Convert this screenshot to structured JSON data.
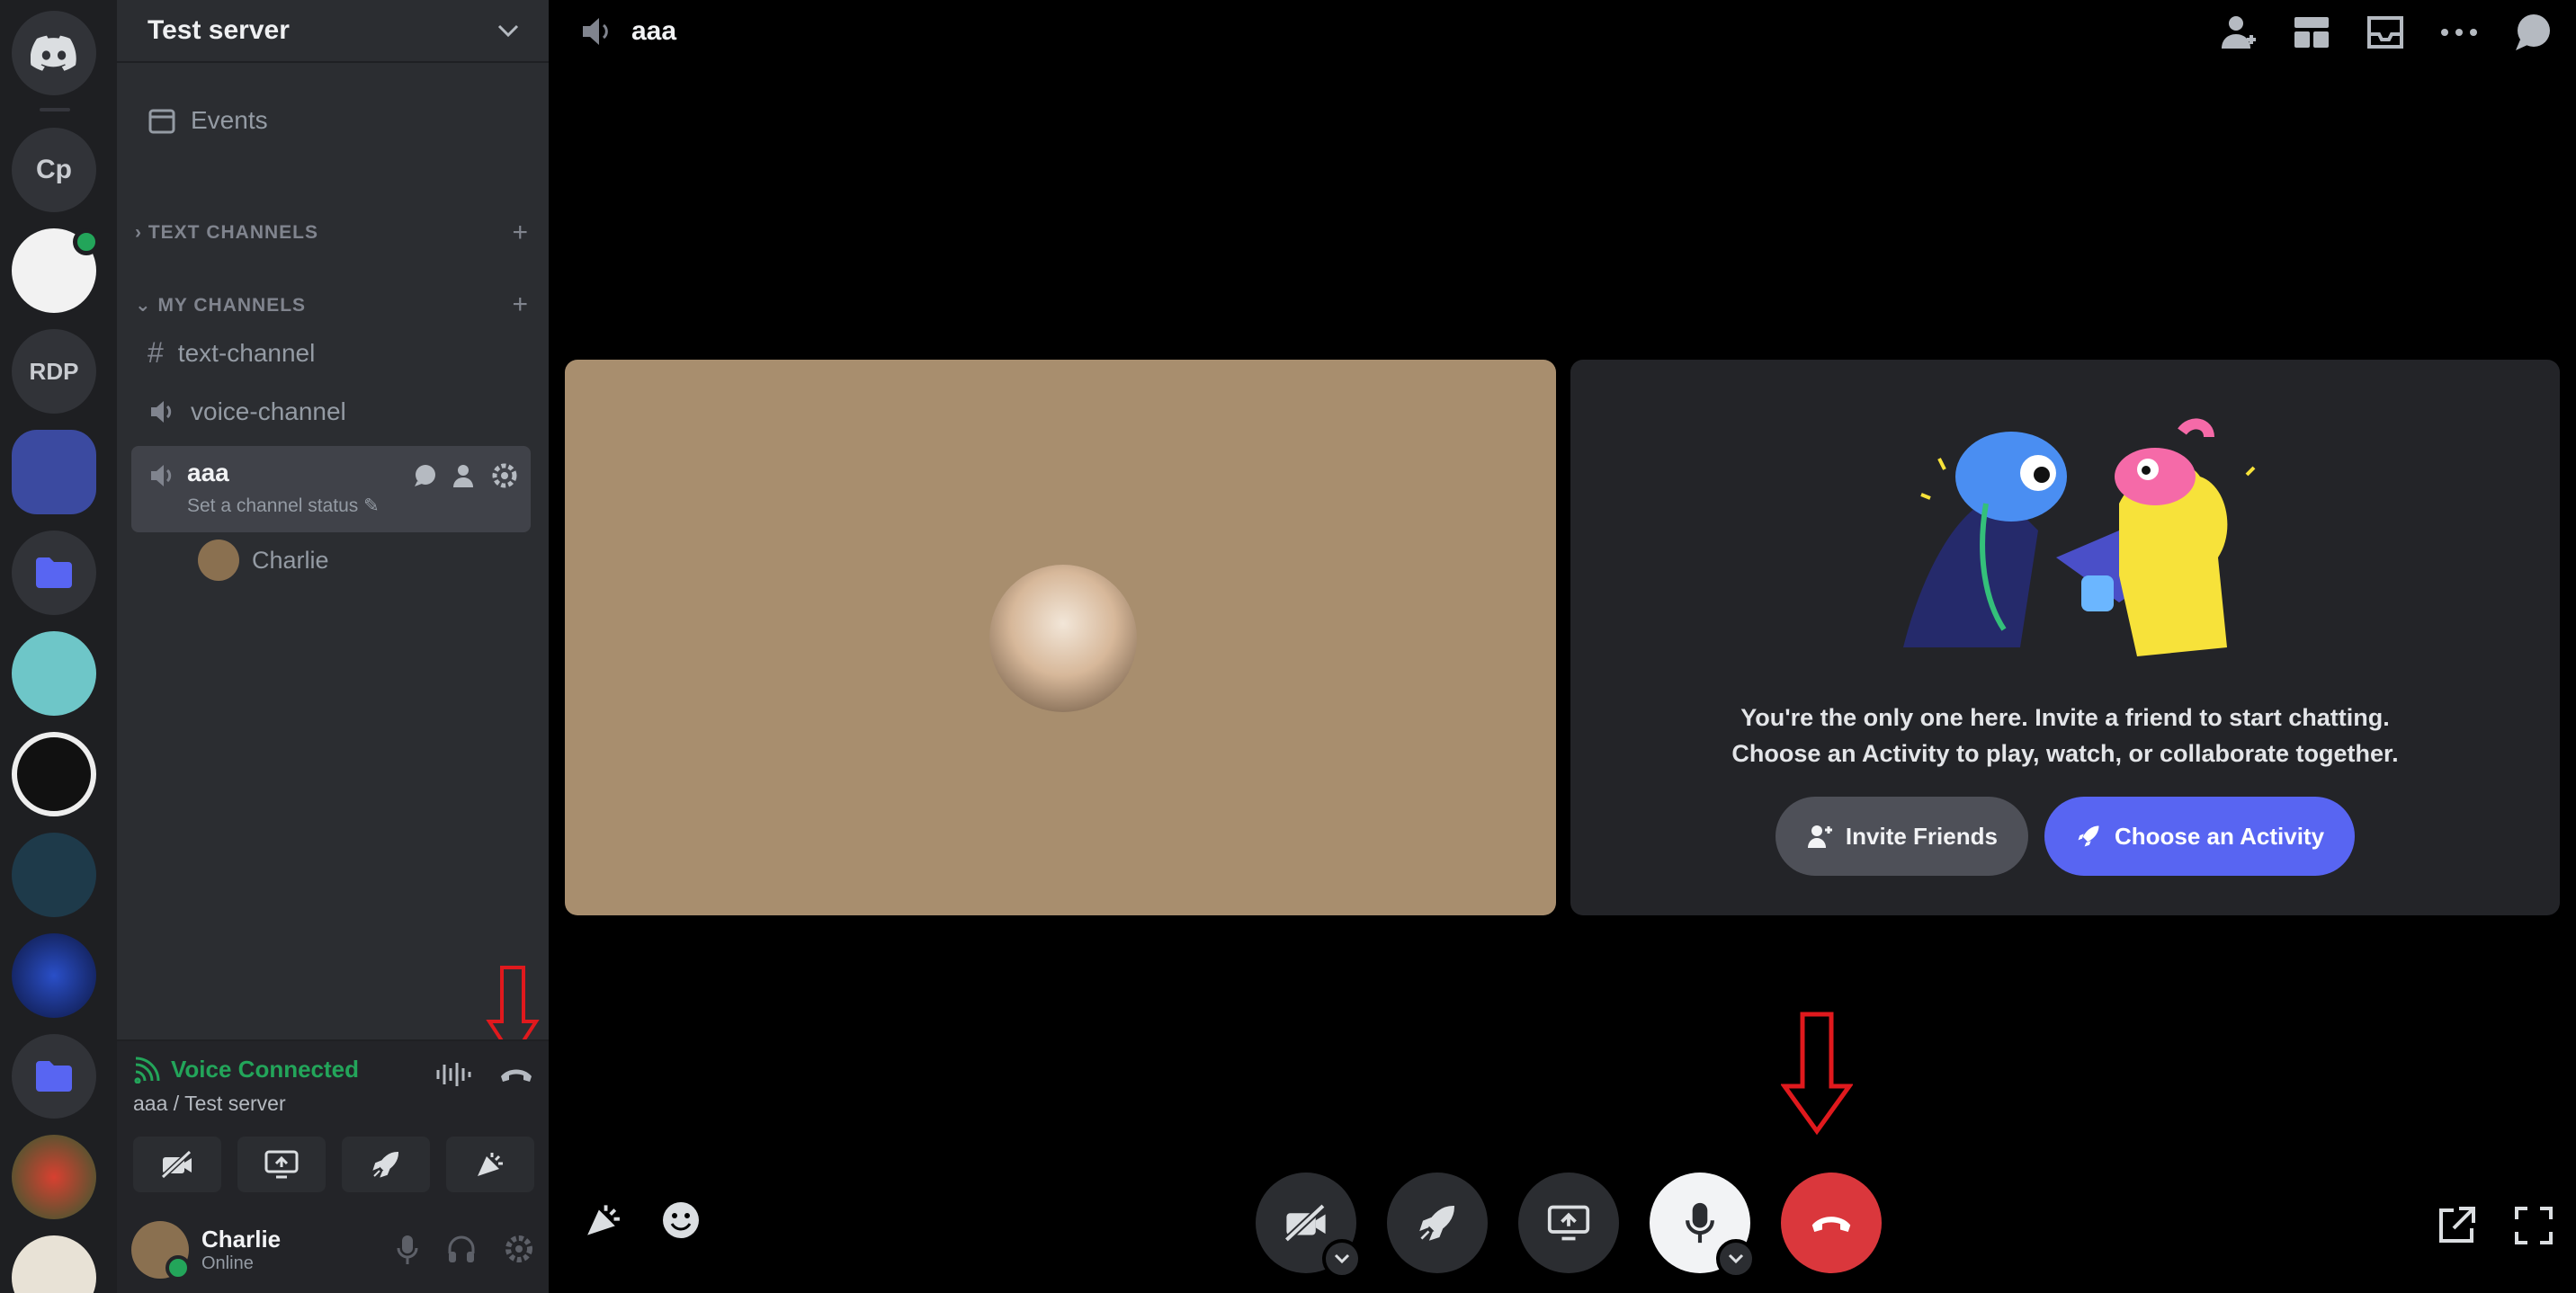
{
  "servers": [
    {
      "kind": "logo",
      "label": "discord-logo"
    },
    {
      "kind": "text",
      "label": "Cp"
    },
    {
      "kind": "image",
      "label": ""
    },
    {
      "kind": "text",
      "label": "RDP"
    },
    {
      "kind": "image",
      "label": ""
    },
    {
      "kind": "folder",
      "label": ""
    },
    {
      "kind": "image",
      "label": ""
    },
    {
      "kind": "image",
      "label": ""
    },
    {
      "kind": "image",
      "label": ""
    },
    {
      "kind": "image",
      "label": ""
    },
    {
      "kind": "folder",
      "label": ""
    },
    {
      "kind": "image",
      "label": ""
    }
  ],
  "sidebar": {
    "server_name": "Test server",
    "events_label": "Events",
    "category_text": "TEXT CHANNELS",
    "category_mine": "MY CHANNELS",
    "channels": [
      {
        "name": "text-channel",
        "type": "text"
      },
      {
        "name": "voice-channel",
        "type": "voice"
      }
    ],
    "active_channel": {
      "name": "aaa",
      "status": "Set a channel status"
    },
    "member": "Charlie"
  },
  "voice_panel": {
    "title": "Voice Connected",
    "subtitle": "aaa / Test server"
  },
  "user_panel": {
    "name": "Charlie",
    "status": "Online"
  },
  "main": {
    "channel_title": "aaa",
    "invite_line1": "You're the only one here. Invite a friend to start chatting.",
    "invite_line2": "Choose an Activity to play, watch, or collaborate together.",
    "invite_button": "Invite Friends",
    "activity_button": "Choose an Activity"
  },
  "colors": {
    "accent": "#5865f2",
    "connected": "#23a55a",
    "hangup": "#da373c",
    "annotation_arrow": "#e0191d",
    "video_tile": "#a88e6e"
  }
}
